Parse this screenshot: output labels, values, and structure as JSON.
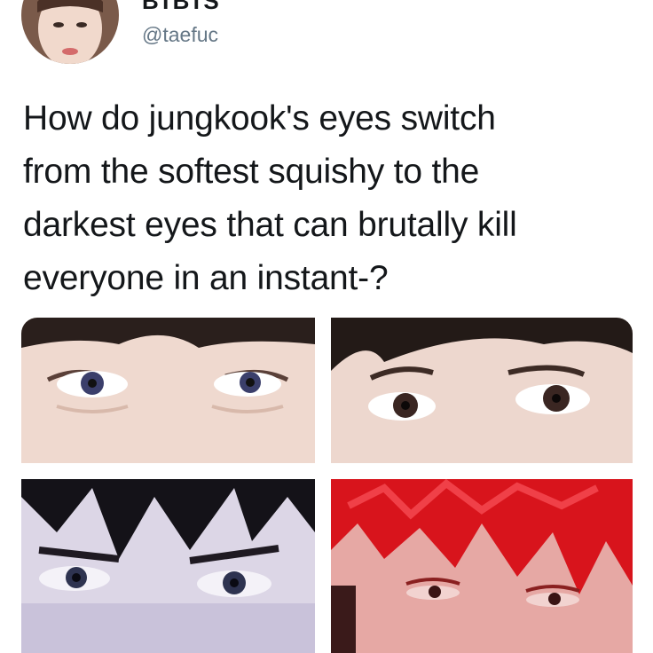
{
  "tweet": {
    "display_name": "BTBTS",
    "handle": "@taefuc",
    "text_lines": [
      "How do jungkook's eyes switch",
      "from the softest squishy to the",
      "darkest eyes that can brutally kill",
      "everyone in an instant-?"
    ]
  },
  "media": {
    "photos": [
      {
        "subject": "soft-eyes-closeup"
      },
      {
        "subject": "soft-eyes-closeup"
      },
      {
        "subject": "dark-eyes-closeup"
      },
      {
        "subject": "dark-eyes-red-hair-closeup"
      }
    ]
  },
  "colors": {
    "text": "#14171a",
    "handle": "#657786",
    "red_hair": "#d8141c"
  }
}
